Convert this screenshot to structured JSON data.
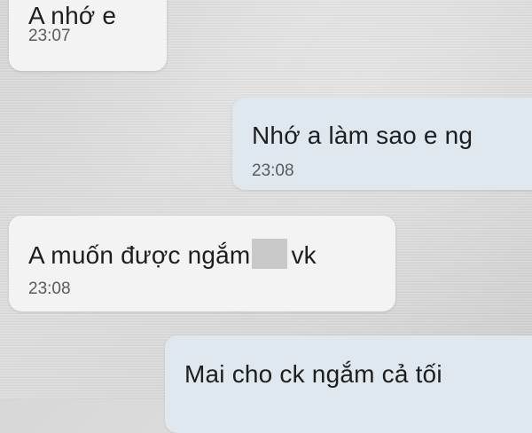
{
  "chat": {
    "messages": [
      {
        "direction": "incoming",
        "text": "A nhớ e",
        "time": "23:07"
      },
      {
        "direction": "outgoing",
        "text": "Nhớ a làm sao e ng",
        "time": "23:08"
      },
      {
        "direction": "incoming",
        "text_before": "A muốn được ngắm",
        "text_after": "vk",
        "censored": true,
        "time": "23:08"
      },
      {
        "direction": "outgoing",
        "text": "Mai cho ck ngắm cả tối",
        "time": ""
      }
    ]
  },
  "colors": {
    "incoming_bubble": "#f3f3f3",
    "outgoing_bubble": "#dfe8ee",
    "text": "#1e1e1e",
    "time": "#5a5a5a"
  }
}
